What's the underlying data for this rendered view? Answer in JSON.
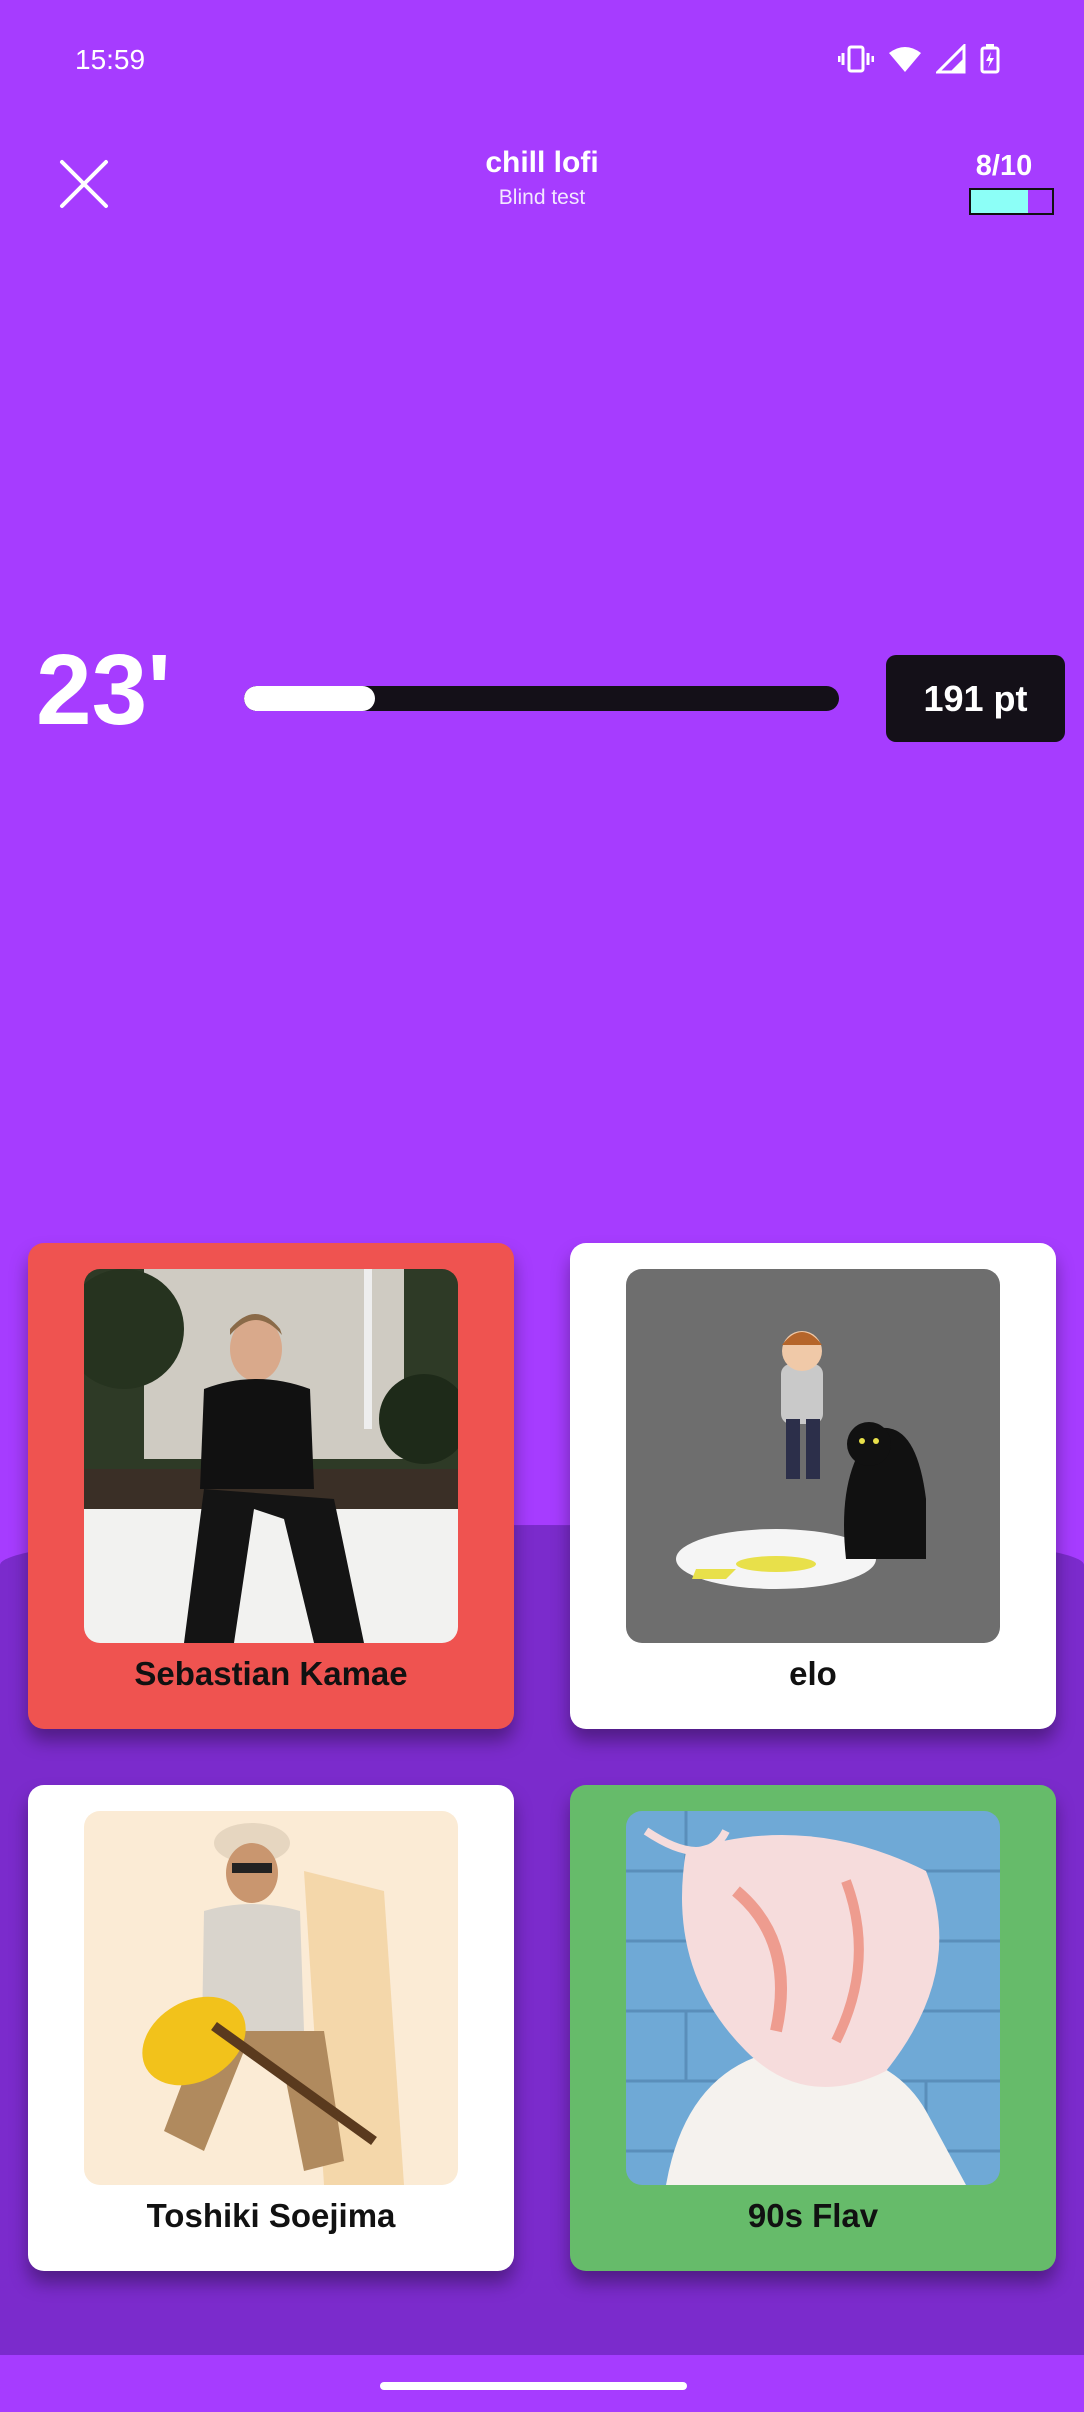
{
  "status_bar": {
    "time": "15:59"
  },
  "header": {
    "title": "chill lofi",
    "subtitle": "Blind test",
    "progress": "8/10",
    "progress_fraction": 0.7
  },
  "round": {
    "timer": "23'",
    "time_remaining_fraction": 0.22,
    "points": "191 pt"
  },
  "answers": [
    {
      "name": "Sebastian Kamae",
      "state": "wrong",
      "color": "#EF5350"
    },
    {
      "name": "elo",
      "state": "neutral",
      "color": "#FFFFFF"
    },
    {
      "name": "Toshiki Soejima",
      "state": "neutral",
      "color": "#FFFFFF"
    },
    {
      "name": "90s Flav",
      "state": "correct",
      "color": "#66BB6A"
    }
  ],
  "colors": {
    "background": "#A63CFF",
    "accent": "#8CFFF7",
    "dark": "#141018"
  }
}
